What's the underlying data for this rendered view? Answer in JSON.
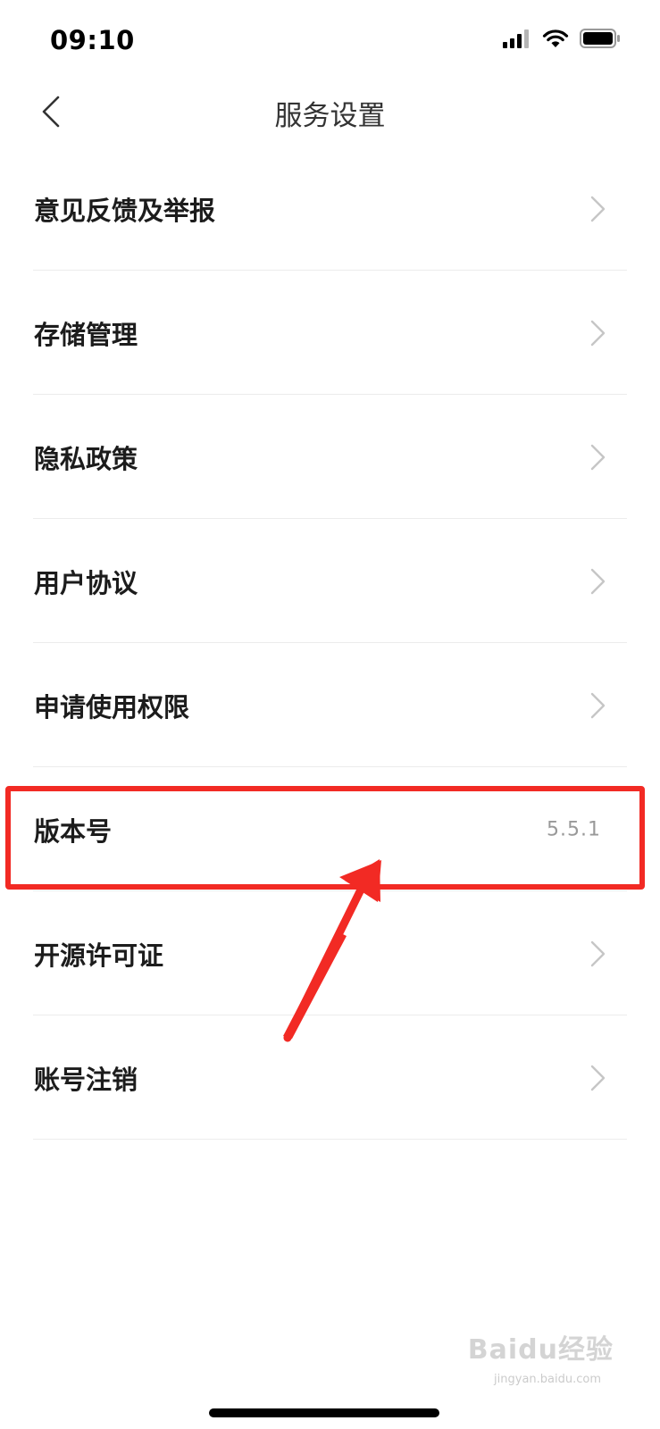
{
  "status_bar": {
    "time": "09:10",
    "signal_icon": "cellular-signal-icon",
    "wifi_icon": "wifi-icon",
    "battery_icon": "battery-icon"
  },
  "nav": {
    "title": "服务设置",
    "back_icon": "chevron-left-icon"
  },
  "settings": {
    "items": [
      {
        "label": "意见反馈及举报",
        "icon": "chevron-right-icon"
      },
      {
        "label": "存储管理",
        "icon": "chevron-right-icon"
      },
      {
        "label": "隐私政策",
        "icon": "chevron-right-icon"
      },
      {
        "label": "用户协议",
        "icon": "chevron-right-icon"
      },
      {
        "label": "申请使用权限",
        "icon": "chevron-right-icon"
      },
      {
        "label": "版本号",
        "value": "5.5.1"
      },
      {
        "label": "开源许可证",
        "icon": "chevron-right-icon"
      },
      {
        "label": "账号注销",
        "icon": "chevron-right-icon"
      }
    ]
  },
  "annotation": {
    "highlight_color": "#f22a24",
    "arrow_color": "#f22a24"
  },
  "watermark": {
    "main": "Baidu经验",
    "sub": "jingyan.baidu.com"
  }
}
